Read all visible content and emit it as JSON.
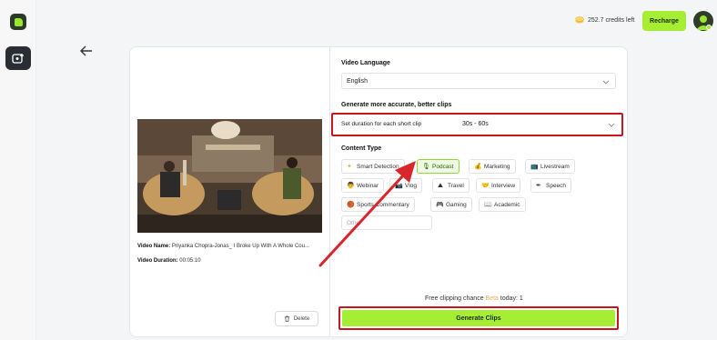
{
  "header": {
    "credits": "252.7 credits left",
    "recharge_label": "Recharge"
  },
  "video": {
    "name_label": "Video Name:",
    "name_value": "Priyanka Chopra-Jonas_ I Broke Up With A Whole Cou...",
    "duration_label": "Video Duration:",
    "duration_value": "00:05:10",
    "delete_label": "Delete"
  },
  "form": {
    "language_label": "Video Language",
    "language_value": "English",
    "accuracy_label": "Generate more accurate, better clips",
    "duration_label": "Set duration for each short clip",
    "duration_value": "30s - 60s",
    "content_type_label": "Content Type",
    "content_types": [
      {
        "label": "Smart Detection",
        "icon": "sparkle-icon",
        "active": false
      },
      {
        "label": "Podcast",
        "icon": "microphone-icon",
        "active": true
      },
      {
        "label": "Marketing",
        "icon": "bag-icon",
        "active": false
      },
      {
        "label": "Livestream",
        "icon": "tv-icon",
        "active": false
      },
      {
        "label": "Webinar",
        "icon": "person-icon",
        "active": false
      },
      {
        "label": "Vlog",
        "icon": "camera-icon",
        "active": false
      },
      {
        "label": "Travel",
        "icon": "mountain-icon",
        "active": false
      },
      {
        "label": "Interview",
        "icon": "handshake-icon",
        "active": false
      },
      {
        "label": "Speech",
        "icon": "pen-icon",
        "active": false
      },
      {
        "label": "Sports Commentary",
        "icon": "ball-icon",
        "active": false
      },
      {
        "label": "Gaming",
        "icon": "gamepad-icon",
        "active": false
      },
      {
        "label": "Academic",
        "icon": "book-icon",
        "active": false
      }
    ],
    "other_placeholder": "Other",
    "chance_prefix": "Free clipping chance",
    "chance_beta": "Beta",
    "chance_suffix": "today: 1",
    "generate_label": "Generate Clips"
  },
  "colors": {
    "accent": "#a6ee34",
    "highlight": "#c8161d",
    "beta": "#e6b25c"
  }
}
